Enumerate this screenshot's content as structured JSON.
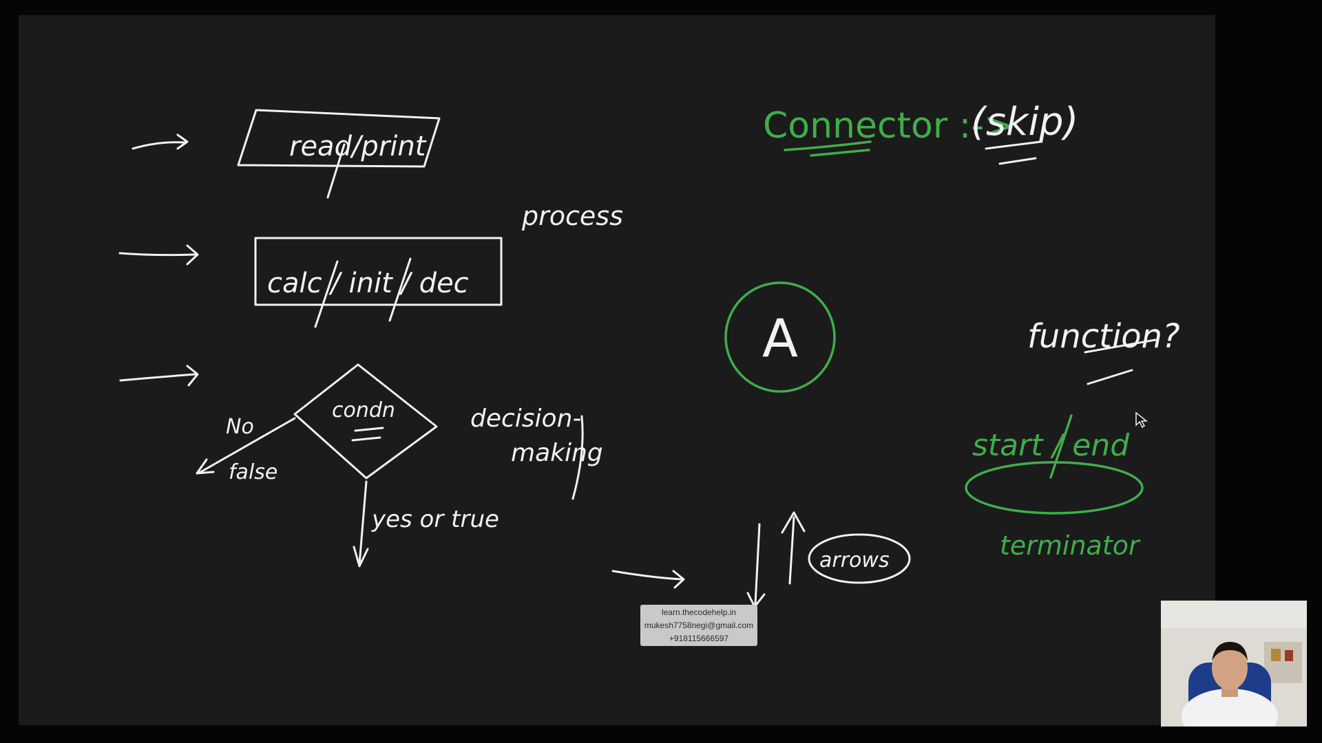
{
  "colors": {
    "background": "#050505",
    "board": "#1b1b1b",
    "chalk_white": "#f2f2f2",
    "chalk_green": "#3fae4a"
  },
  "left_shapes": {
    "io_label": "read/print",
    "process_label": "calc / init / dec",
    "process_caption": "process",
    "decision_label": "condn",
    "decision_caption_1": "decision-",
    "decision_caption_2": "making",
    "no_label": "No",
    "false_label": "false",
    "yes_label": "yes or true"
  },
  "right_shapes": {
    "connector_title": "Connector :->",
    "skip_label": "(skip)",
    "connector_symbol": "A",
    "function_label": "function?",
    "start_end_label": "start / end",
    "terminator_label": "terminator",
    "arrows_label": "arrows"
  },
  "watermark": {
    "line1": "learn.thecodehelp.in",
    "line2": "mukesh7758negi@gmail.com",
    "line3": "+918115666597"
  }
}
